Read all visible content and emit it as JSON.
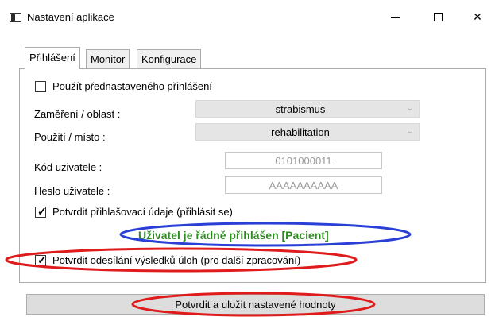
{
  "window": {
    "title": "Nastavení aplikace",
    "close_glyph": "✕"
  },
  "tabs": [
    {
      "label": "Přihlášení",
      "active": true
    },
    {
      "label": "Monitor",
      "active": false
    },
    {
      "label": "Konfigurace",
      "active": false
    }
  ],
  "login": {
    "preset_label": "Použít přednastaveného přihlášení",
    "preset_checked": false,
    "focus_label": "Zaměření / oblast :",
    "focus_value": "strabismus",
    "use_label": "Použití / místo :",
    "use_value": "rehabilitation",
    "user_code_label": "Kód uzivatele :",
    "user_code_value": "0101000011",
    "password_label": "Heslo uživatele :",
    "password_value": "AAAAAAAAAA",
    "confirm_label": "Potvrdit přihlašovací údaje (přihlásit se)",
    "confirm_checked": true,
    "status_text": "Uživatel je řádně přihlášen [Pacient]",
    "send_label": "Potvrdit odesílání výsledků úloh (pro další zpracování)",
    "send_checked": true,
    "check_glyph": "✓",
    "dropdown_glyph": "⌄"
  },
  "save_button": "Potvrdit a uložit nastavené hodnoty",
  "colors": {
    "status_text": "#2f8a24",
    "highlight_blue": "#2a3fd6",
    "highlight_red": "#e01b1b"
  },
  "icons": {
    "app": "app-window-icon",
    "minimize": "minimize-icon",
    "maximize": "maximize-icon",
    "close": "close-icon",
    "checkbox_checked": "check-icon",
    "combo_arrow": "chevron-down-icon"
  }
}
